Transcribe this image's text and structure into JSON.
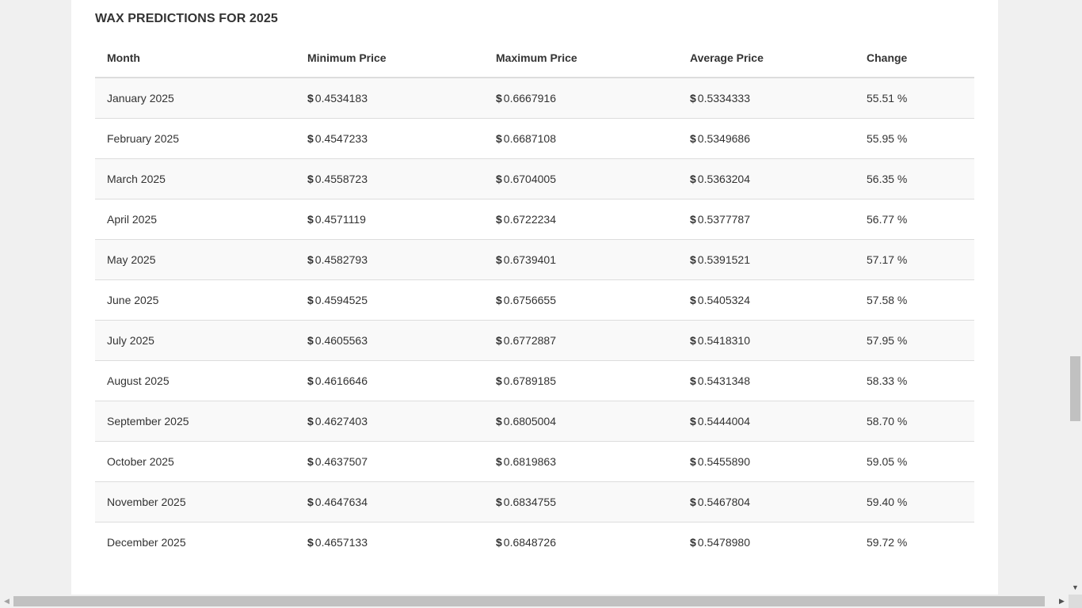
{
  "title": "WAX PREDICTIONS FOR 2025",
  "currency_symbol": "$",
  "columns": [
    "Month",
    "Minimum Price",
    "Maximum Price",
    "Average Price",
    "Change"
  ],
  "rows": [
    {
      "month": "January 2025",
      "min": "0.4534183",
      "max": "0.6667916",
      "avg": "0.5334333",
      "change": "55.51 %"
    },
    {
      "month": "February 2025",
      "min": "0.4547233",
      "max": "0.6687108",
      "avg": "0.5349686",
      "change": "55.95 %"
    },
    {
      "month": "March 2025",
      "min": "0.4558723",
      "max": "0.6704005",
      "avg": "0.5363204",
      "change": "56.35 %"
    },
    {
      "month": "April 2025",
      "min": "0.4571119",
      "max": "0.6722234",
      "avg": "0.5377787",
      "change": "56.77 %"
    },
    {
      "month": "May 2025",
      "min": "0.4582793",
      "max": "0.6739401",
      "avg": "0.5391521",
      "change": "57.17 %"
    },
    {
      "month": "June 2025",
      "min": "0.4594525",
      "max": "0.6756655",
      "avg": "0.5405324",
      "change": "57.58 %"
    },
    {
      "month": "July 2025",
      "min": "0.4605563",
      "max": "0.6772887",
      "avg": "0.5418310",
      "change": "57.95 %"
    },
    {
      "month": "August 2025",
      "min": "0.4616646",
      "max": "0.6789185",
      "avg": "0.5431348",
      "change": "58.33 %"
    },
    {
      "month": "September 2025",
      "min": "0.4627403",
      "max": "0.6805004",
      "avg": "0.5444004",
      "change": "58.70 %"
    },
    {
      "month": "October 2025",
      "min": "0.4637507",
      "max": "0.6819863",
      "avg": "0.5455890",
      "change": "59.05 %"
    },
    {
      "month": "November 2025",
      "min": "0.4647634",
      "max": "0.6834755",
      "avg": "0.5467804",
      "change": "59.40 %"
    },
    {
      "month": "December 2025",
      "min": "0.4657133",
      "max": "0.6848726",
      "avg": "0.5478980",
      "change": "59.72 %"
    }
  ],
  "icons": {
    "scroll_up": "arrow-up-icon",
    "scroll_down": "arrow-down-icon",
    "scroll_left": "arrow-left-icon",
    "scroll_right": "arrow-right-icon"
  },
  "colors": {
    "page_bg": "#f0f0f0",
    "panel_bg": "#ffffff",
    "stripe": "#f9f9f9",
    "border": "#dddddd",
    "text": "#333333"
  }
}
